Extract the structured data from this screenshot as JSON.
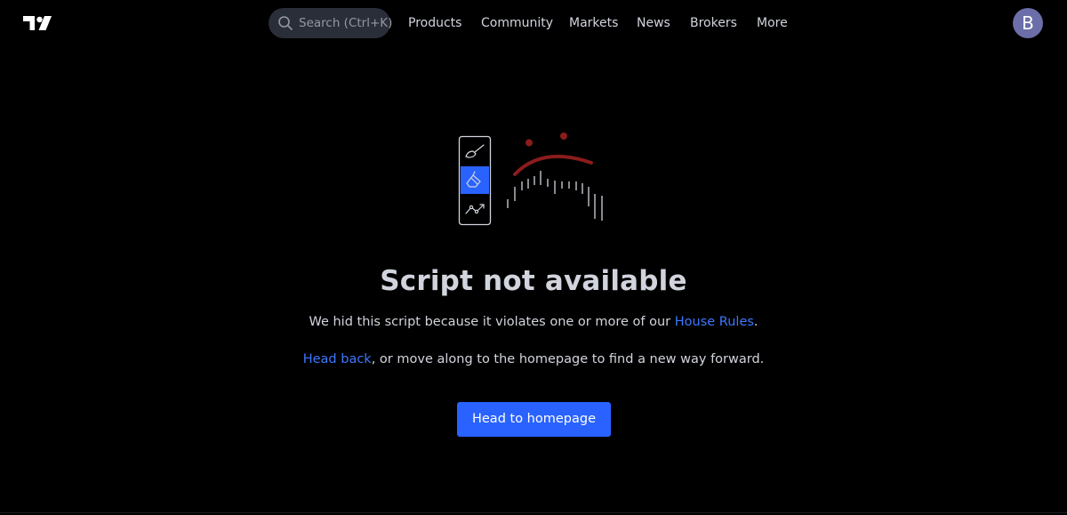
{
  "header": {
    "logo": "tradingview-logo",
    "search_placeholder": "Search (Ctrl+K)",
    "nav": [
      {
        "label": "Products"
      },
      {
        "label": "Community"
      },
      {
        "label": "Markets"
      },
      {
        "label": "News"
      },
      {
        "label": "Brokers"
      },
      {
        "label": "More"
      }
    ],
    "avatar_initial": "B"
  },
  "illustration": {
    "icons": [
      "brush-icon",
      "eraser-icon",
      "trend-line-icon"
    ],
    "accent_color": "#2962ff",
    "sad_face_color": "#8b1c1c"
  },
  "main": {
    "title": "Script not available",
    "line1_text": "We hid this script because it violates one or more of our ",
    "line1_link": "House Rules",
    "line1_end": ".",
    "line2_link": "Head back",
    "line2_text": ", or move along to the homepage to find a new way forward.",
    "cta_label": "Head to homepage"
  },
  "colors": {
    "background": "#000000",
    "text": "#d1d4dc",
    "link": "#3d78ff",
    "button": "#2962ff",
    "search_bg": "#2a2e39",
    "avatar_bg": "#6b6ea8"
  }
}
